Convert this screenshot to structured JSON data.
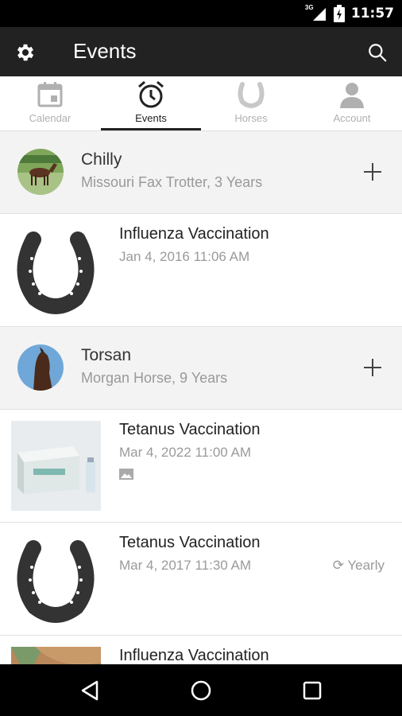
{
  "status": {
    "network": "3G",
    "time": "11:57"
  },
  "appbar": {
    "title": "Events",
    "settings_icon": "gear-icon",
    "search_icon": "search-icon"
  },
  "tabs": [
    {
      "label": "Calendar",
      "icon": "calendar-icon",
      "active": false
    },
    {
      "label": "Events",
      "icon": "alarm-clock-icon",
      "active": true
    },
    {
      "label": "Horses",
      "icon": "horseshoe-icon",
      "active": false
    },
    {
      "label": "Account",
      "icon": "person-icon",
      "active": false
    }
  ],
  "horses": [
    {
      "name": "Chilly",
      "details": "Missouri Fax Trotter, 3 Years",
      "events": [
        {
          "title": "Influenza Vaccination",
          "date": "Jan 4, 2016 11:06 AM",
          "thumbnail": "horseshoe"
        }
      ]
    },
    {
      "name": "Torsan",
      "details": "Morgan Horse, 9 Years",
      "events": [
        {
          "title": "Tetanus Vaccination",
          "date": "Mar 4, 2022 11:00 AM",
          "thumbnail": "vaccine-box-photo",
          "has_image": true
        },
        {
          "title": "Tetanus Vaccination",
          "date": "Mar 4, 2017 11:30 AM",
          "thumbnail": "horseshoe",
          "recurrence": "Yearly"
        },
        {
          "title": "Influenza Vaccination",
          "date": "",
          "thumbnail": "horse-photo"
        }
      ]
    }
  ],
  "navbar": {
    "back_icon": "back-triangle-icon",
    "home_icon": "home-circle-icon",
    "recents_icon": "recents-square-icon"
  },
  "colors": {
    "appbar": "#222222",
    "header_bg": "#f3f3f3",
    "inactive_tab": "#b0b0b0",
    "horseshoe": "#333333"
  }
}
